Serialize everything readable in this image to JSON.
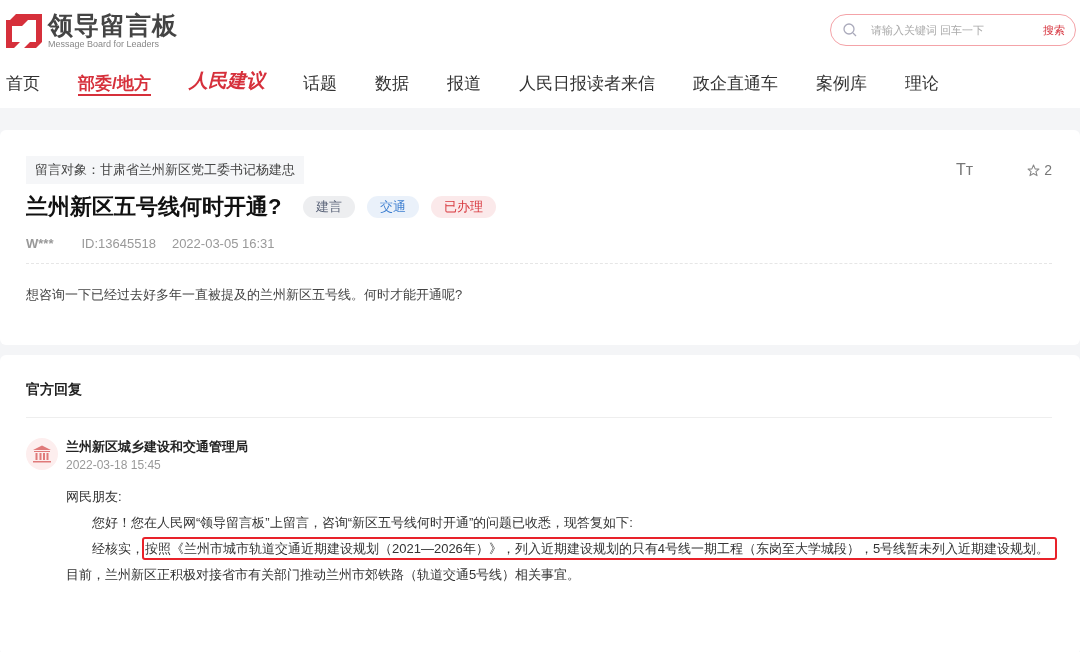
{
  "header": {
    "logo_title": "领导留言板",
    "logo_subtitle": "Message Board for Leaders",
    "search": {
      "placeholder": "请输入关键词 回车一下",
      "button": "搜索"
    }
  },
  "nav": [
    {
      "label": "首页",
      "kind": "text",
      "selected": false
    },
    {
      "label": "部委/地方",
      "kind": "text",
      "selected": true
    },
    {
      "label": "人民建议",
      "kind": "logo",
      "selected": false
    },
    {
      "label": "话题",
      "kind": "text",
      "selected": false
    },
    {
      "label": "数据",
      "kind": "text",
      "selected": false
    },
    {
      "label": "报道",
      "kind": "text",
      "selected": false
    },
    {
      "label": "人民日报读者来信",
      "kind": "text",
      "selected": false
    },
    {
      "label": "政企直通车",
      "kind": "text",
      "selected": false
    },
    {
      "label": "案例库",
      "kind": "text",
      "selected": false
    },
    {
      "label": "理论",
      "kind": "text",
      "selected": false
    }
  ],
  "message": {
    "target": "留言对象：甘肃省兰州新区党工委书记杨建忠",
    "font_toggle": "Tт",
    "favorites": "2",
    "title": "兰州新区五号线何时开通?",
    "tags": [
      {
        "label": "建言",
        "color": "#5a6378"
      },
      {
        "label": "交通",
        "color": "#3e7fd0"
      },
      {
        "label": "已办理",
        "color": "#d8393f"
      }
    ],
    "author": "W***",
    "id": "ID:13645518",
    "time": "2022-03-05 16:31",
    "body": "想咨询一下已经过去好多年一直被提及的兰州新区五号线。何时才能开通呢?"
  },
  "reply": {
    "heading": "官方回复",
    "department": "兰州新区城乡建设和交通管理局",
    "time": "2022-03-18 15:45",
    "paragraphs": [
      {
        "kind": "flush",
        "text": "网民朋友:"
      },
      {
        "kind": "indented",
        "text": "您好！您在人民网“领导留言板”上留言，咨询“新区五号线何时开通”的问题已收悉，现答复如下:"
      },
      {
        "kind": "indented",
        "text": "经核实，",
        "marked": "按照《兰州市城市轨道交通近期建设规划（2021—2026年）》，列入近期建设规划的只有4号线一期工程（东岗至大学城段），5号线暂未列入近期建设规划。"
      },
      {
        "kind": "flush",
        "text": "目前，兰州新区正积极对接省市有关部门推动兰州市郊铁路（轨道交通5号线）相关事宜。"
      }
    ]
  }
}
